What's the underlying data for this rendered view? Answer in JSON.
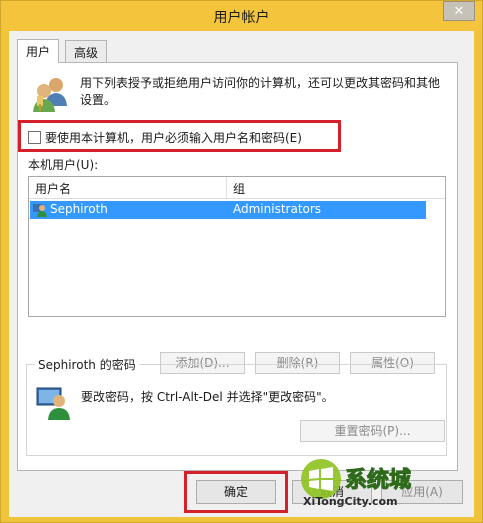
{
  "window": {
    "title": "用户帐户",
    "close_glyph": "✕"
  },
  "tabs": [
    {
      "label": "用户",
      "active": true
    },
    {
      "label": "高级",
      "active": false
    }
  ],
  "intro": {
    "text": "用下列表授予或拒绝用户访问你的计算机，还可以更改其密码和其他设置。"
  },
  "require_login": {
    "label": "要使用本计算机，用户必须输入用户名和密码(E)",
    "checked": false
  },
  "users": {
    "label": "本机用户(U):",
    "columns": [
      "用户名",
      "组"
    ],
    "rows": [
      {
        "name": "Sephiroth",
        "group": "Administrators",
        "selected": true
      }
    ]
  },
  "list_buttons": {
    "add": "添加(D)...",
    "remove": "删除(R)",
    "properties": "属性(O)"
  },
  "password_group": {
    "title": "Sephiroth 的密码",
    "text": "要改密码，按 Ctrl-Alt-Del 并选择\"更改密码\"。",
    "reset": "重置密码(P)..."
  },
  "footer": {
    "ok": "确定",
    "cancel": "取消",
    "apply": "应用(A)"
  },
  "watermark": {
    "brand": "系统城",
    "url": "XiTongCity.com"
  },
  "colors": {
    "title_bar": "#f4c53c",
    "selection": "#3399ff",
    "highlight": "#d3202a"
  }
}
